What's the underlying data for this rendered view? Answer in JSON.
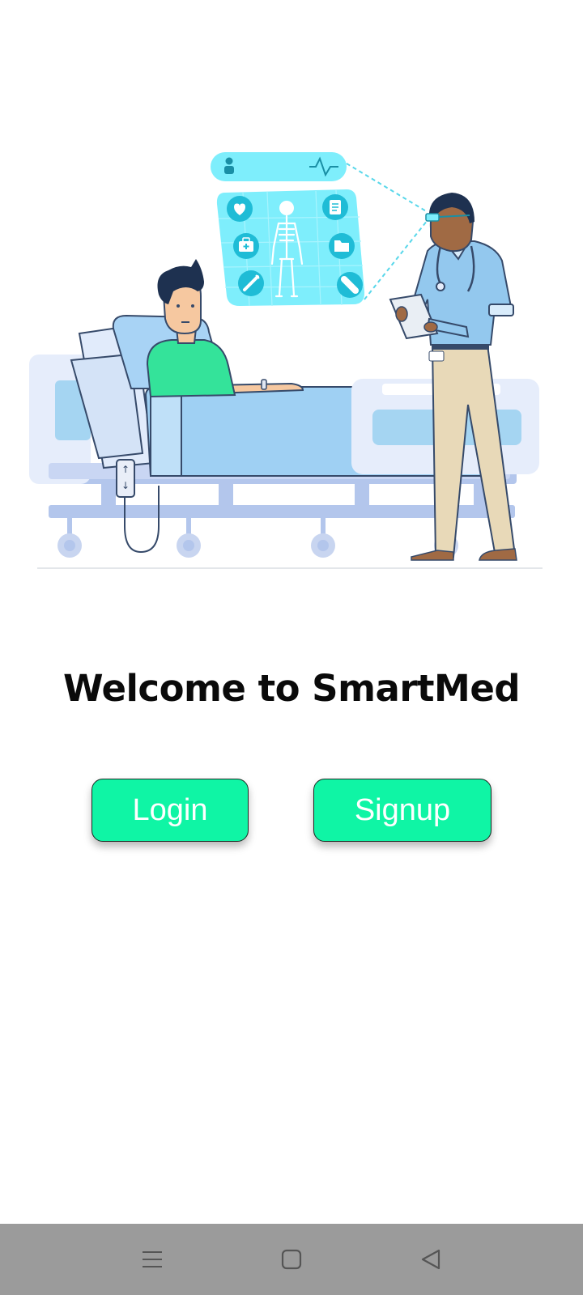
{
  "welcome": {
    "title": "Welcome to SmartMed"
  },
  "buttons": {
    "login_label": "Login",
    "signup_label": "Signup"
  },
  "colors": {
    "accent": "#0ff5a5",
    "nav_bar": "#9b9b9b",
    "title": "#0a0a0a"
  },
  "illustration": {
    "subject": "doctor-with-tablet-and-patient-in-hospital-bed",
    "panel_icons": [
      "heart-pulse-icon",
      "document-icon",
      "first-aid-kit-icon",
      "folder-icon",
      "syringe-icon",
      "pill-icon",
      "skeleton-icon"
    ]
  },
  "system_nav": {
    "icons": [
      "menu-icon",
      "home-icon",
      "back-icon"
    ]
  }
}
